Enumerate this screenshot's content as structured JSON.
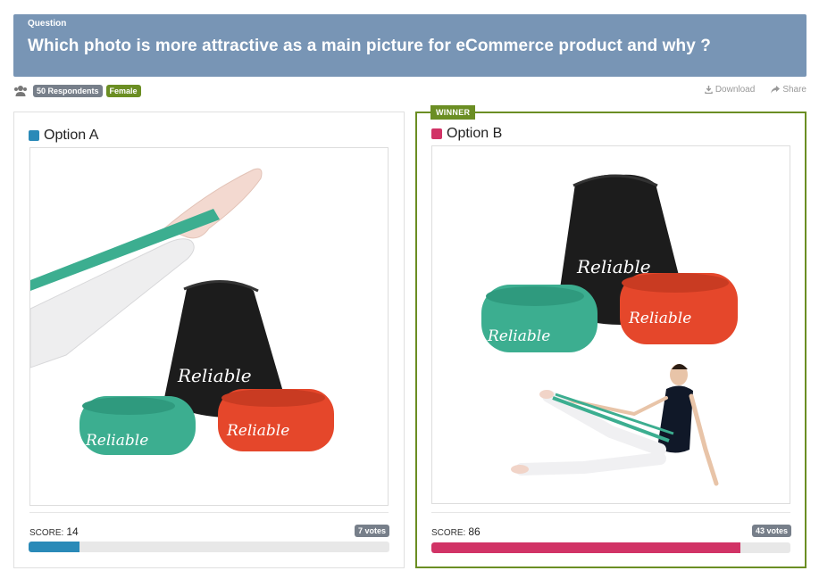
{
  "question": {
    "label": "Question",
    "text": "Which photo is more attractive as a main picture for eCommerce product and why ?"
  },
  "meta": {
    "respondents": "50 Respondents",
    "audience": "Female",
    "download": "Download",
    "share": "Share"
  },
  "options": [
    {
      "title": "Option A",
      "color": "#2a8ab8",
      "score_label": "SCORE:",
      "score": "14",
      "score_pct": 14,
      "votes": "7 votes",
      "brand": "Reliable"
    },
    {
      "title": "Option B",
      "color": "#d13366",
      "winner_label": "WINNER",
      "score_label": "SCORE:",
      "score": "86",
      "score_pct": 86,
      "votes": "43 votes",
      "brand": "Reliable"
    }
  ],
  "colors": {
    "header_bg": "#7895b5",
    "winner_green": "#6b8e23",
    "band_teal": "#3cae90",
    "band_red": "#e5472b",
    "bag_black": "#1c1c1c"
  }
}
